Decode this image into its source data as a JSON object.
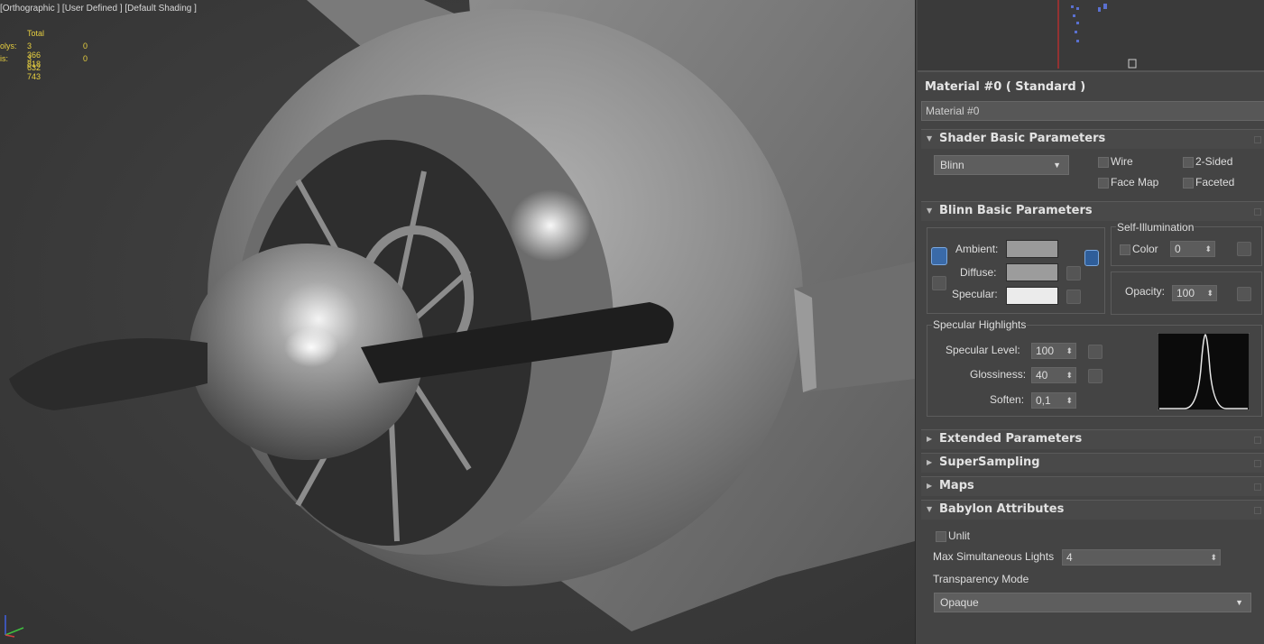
{
  "viewport": {
    "label": "[Orthographic ] [User Defined ] [Default Shading ]",
    "stats": {
      "header": "Total",
      "polys_label": "olys:",
      "polys_value": "3 366 818",
      "polys_sel": "0",
      "tris_label": "is:",
      "tris_value": "3 632 743",
      "tris_sel": "0"
    }
  },
  "material": {
    "title": "Material #0  ( Standard )",
    "name": "Material #0"
  },
  "shader_basic": {
    "heading": "Shader Basic Parameters",
    "shader": "Blinn",
    "wire": "Wire",
    "two_sided": "2-Sided",
    "face_map": "Face Map",
    "faceted": "Faceted"
  },
  "blinn_basic": {
    "heading": "Blinn Basic Parameters",
    "ambient": "Ambient:",
    "diffuse": "Diffuse:",
    "specular": "Specular:",
    "self_illum": "Self-Illumination",
    "color": "Color",
    "color_value": "0",
    "opacity": "Opacity:",
    "opacity_value": "100",
    "spec_highlights": "Specular Highlights",
    "spec_level": "Specular Level:",
    "spec_level_value": "100",
    "glossiness": "Glossiness:",
    "glossiness_value": "40",
    "soften": "Soften:",
    "soften_value": "0,1",
    "colors": {
      "ambient": "#9a9a9a",
      "diffuse": "#9c9c9c",
      "specular": "#ebebeb"
    }
  },
  "rollouts": {
    "extended": "Extended Parameters",
    "supersampling": "SuperSampling",
    "maps": "Maps",
    "babylon": "Babylon Attributes"
  },
  "babylon": {
    "unlit": "Unlit",
    "max_lights": "Max Simultaneous Lights",
    "max_lights_value": "4",
    "transparency_mode": "Transparency Mode",
    "transparency_value": "Opaque"
  }
}
